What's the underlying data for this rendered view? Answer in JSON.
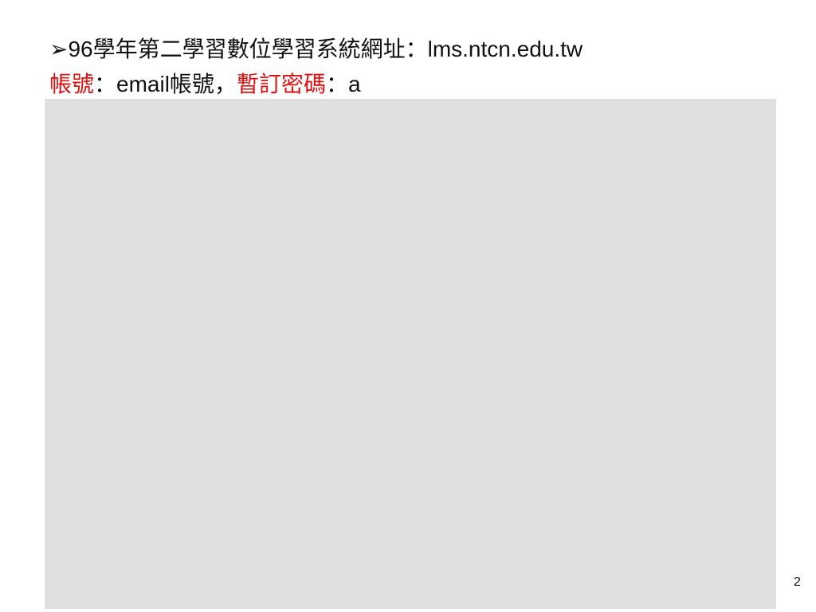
{
  "slide": {
    "heading_url": "➢96學年第二學習數位學習系統網址：lms.ntcn.edu.tw",
    "heading_account_label": "帳號",
    "heading_account_value": "：email帳號，",
    "heading_password_label": "暫訂密碼",
    "heading_password_value": "：a",
    "slide_number": "2"
  }
}
